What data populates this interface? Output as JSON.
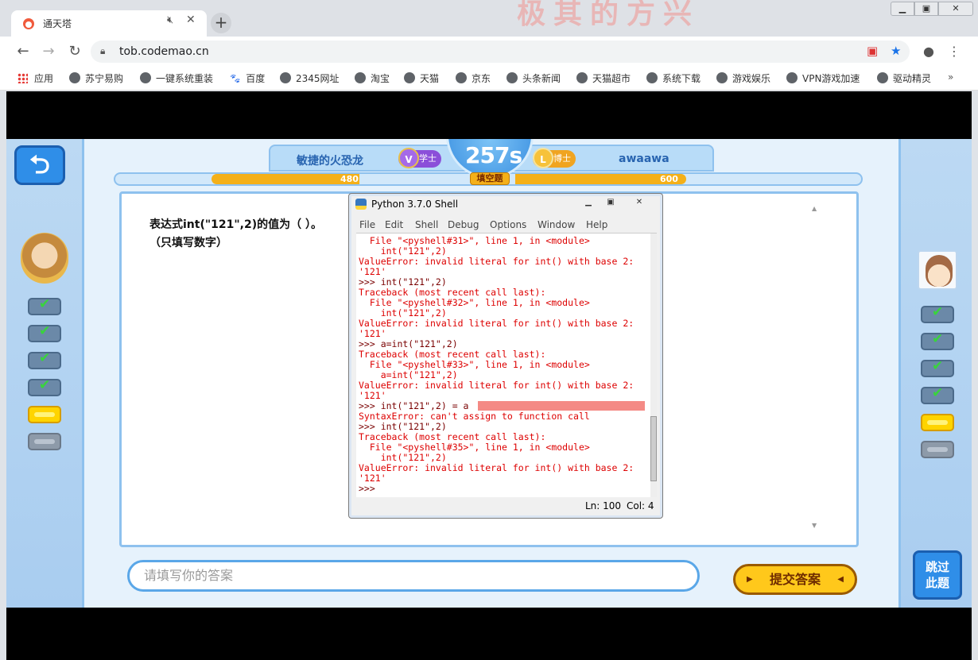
{
  "browser": {
    "tab_title": "通天塔",
    "url": "tob.codemao.cn",
    "hero_text": "极其的方兴",
    "bookmarks": [
      {
        "label": "应用",
        "icon": "apps-grid-icon"
      },
      {
        "label": "苏宁易购",
        "icon": "globe-icon"
      },
      {
        "label": "一键系统重装",
        "icon": "globe-icon"
      },
      {
        "label": "百度",
        "icon": "paw-icon"
      },
      {
        "label": "2345网址",
        "icon": "globe-icon"
      },
      {
        "label": "淘宝",
        "icon": "globe-icon"
      },
      {
        "label": "天猫",
        "icon": "globe-icon"
      },
      {
        "label": "京东",
        "icon": "globe-icon"
      },
      {
        "label": "头条新闻",
        "icon": "globe-icon"
      },
      {
        "label": "天猫超市",
        "icon": "globe-icon"
      },
      {
        "label": "系统下载",
        "icon": "globe-icon"
      },
      {
        "label": "游戏娱乐",
        "icon": "globe-icon"
      },
      {
        "label": "VPN游戏加速",
        "icon": "globe-icon"
      },
      {
        "label": "驱动精灵",
        "icon": "globe-icon"
      }
    ],
    "more": "»"
  },
  "game": {
    "player_left": "敏捷的火恐龙",
    "player_right": "awaawa",
    "badge_left": "学士",
    "badge_left_glyph": "V",
    "badge_right": "博士",
    "badge_right_glyph": "L",
    "timer": "257s",
    "question_type": "填空题",
    "score_left": "480",
    "score_right": "600",
    "question_line1": "表达式int(\"121\",2)的值为（ ）。",
    "question_line2": "（只填写数字）",
    "answer_placeholder": "请填写你的答案",
    "submit_label": "提交答案",
    "skip_label_1": "跳过",
    "skip_label_2": "此题",
    "left_progress": [
      "done",
      "done",
      "done",
      "done",
      "current",
      "pending"
    ],
    "right_progress": [
      "done",
      "done",
      "done",
      "done",
      "current",
      "pending"
    ],
    "colors": {
      "accent_blue": "#2f8ee8",
      "gold": "#ffc81b",
      "check_green": "#39d43c"
    }
  },
  "shell": {
    "title": "Python 3.7.0 Shell",
    "menu": [
      "File",
      "Edit",
      "Shell",
      "Debug",
      "Options",
      "Window",
      "Help"
    ],
    "lines": [
      {
        "text": "  File \"<pyshell#31>\", line 1, in <module>",
        "color": "#dd0000"
      },
      {
        "text": "    int(\"121\",2)",
        "color": "#dd0000"
      },
      {
        "text": "ValueError: invalid literal for int() with base 2:",
        "color": "#dd0000"
      },
      {
        "text": "'121'",
        "color": "#dd0000"
      },
      {
        "text": ">>> int(\"121\",2)",
        "color": "#7a0000"
      },
      {
        "text": "Traceback (most recent call last):",
        "color": "#dd0000"
      },
      {
        "text": "  File \"<pyshell#32>\", line 1, in <module>",
        "color": "#dd0000"
      },
      {
        "text": "    int(\"121\",2)",
        "color": "#dd0000"
      },
      {
        "text": "ValueError: invalid literal for int() with base 2:",
        "color": "#dd0000"
      },
      {
        "text": "'121'",
        "color": "#dd0000"
      },
      {
        "text": ">>> a=int(\"121\",2)",
        "color": "#7a0000"
      },
      {
        "text": "Traceback (most recent call last):",
        "color": "#dd0000"
      },
      {
        "text": "  File \"<pyshell#33>\", line 1, in <module>",
        "color": "#dd0000"
      },
      {
        "text": "    a=int(\"121\",2)",
        "color": "#dd0000"
      },
      {
        "text": "ValueError: invalid literal for int() with base 2:",
        "color": "#dd0000"
      },
      {
        "text": "'121'",
        "color": "#dd0000"
      },
      {
        "text": ">>> int(\"121\",2) = a",
        "color": "#7a0000"
      },
      {
        "text": "SyntaxError: can't assign to function call",
        "color": "#dd0000"
      },
      {
        "text": ">>> int(\"121\",2)",
        "color": "#7a0000"
      },
      {
        "text": "Traceback (most recent call last):",
        "color": "#dd0000"
      },
      {
        "text": "  File \"<pyshell#35>\", line 1, in <module>",
        "color": "#dd0000"
      },
      {
        "text": "    int(\"121\",2)",
        "color": "#dd0000"
      },
      {
        "text": "ValueError: invalid literal for int() with base 2:",
        "color": "#dd0000"
      },
      {
        "text": "'121'",
        "color": "#dd0000"
      },
      {
        "text": ">>>",
        "color": "#7a0000"
      }
    ],
    "status_ln": "Ln: 100",
    "status_col": "Col: 4"
  }
}
